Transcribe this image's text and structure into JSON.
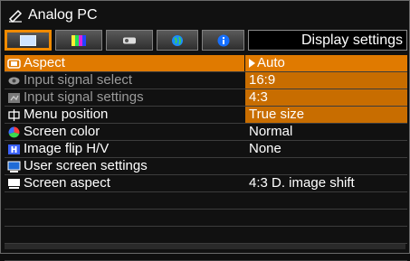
{
  "window": {
    "title": "Analog PC",
    "icon": "pen-icon"
  },
  "tabs": [
    {
      "name": "display-tab",
      "icon": "screen-icon",
      "active": true
    },
    {
      "name": "color-tab",
      "icon": "color-bars-icon",
      "active": false
    },
    {
      "name": "installation-tab",
      "icon": "projector-icon",
      "active": false
    },
    {
      "name": "network-tab",
      "icon": "globe-icon",
      "active": false
    },
    {
      "name": "info-tab",
      "icon": "info-icon",
      "active": false
    }
  ],
  "header": {
    "title": "Display settings"
  },
  "menu": [
    {
      "label": "Aspect",
      "icon": "aspect-icon",
      "value": "Auto",
      "selected": true,
      "dim": false,
      "arrow": true
    },
    {
      "label": "Input signal select",
      "icon": "signal-icon",
      "value": "16:9",
      "selected": false,
      "dim": true
    },
    {
      "label": "Input signal settings",
      "icon": "signal-settings-icon",
      "value": "4:3",
      "selected": false,
      "dim": true
    },
    {
      "label": "Menu position",
      "icon": "crosshair-icon",
      "value": "True size",
      "selected": false,
      "dim": false
    },
    {
      "label": "Screen color",
      "icon": "color-wheel-icon",
      "value": "Normal",
      "selected": false,
      "dim": false
    },
    {
      "label": "Image flip H/V",
      "icon": "flip-icon",
      "value": "None",
      "selected": false,
      "dim": false
    },
    {
      "label": "User screen settings",
      "icon": "user-screen-icon",
      "value": "",
      "selected": false,
      "dim": false
    },
    {
      "label": "Screen aspect",
      "icon": "screen-aspect-icon",
      "value": "4:3 D. image shift",
      "selected": false,
      "dim": false
    }
  ],
  "colors": {
    "accent": "#e07a00",
    "background": "#111111",
    "text": "#ffffff",
    "dim_text": "#9a9a9a"
  }
}
